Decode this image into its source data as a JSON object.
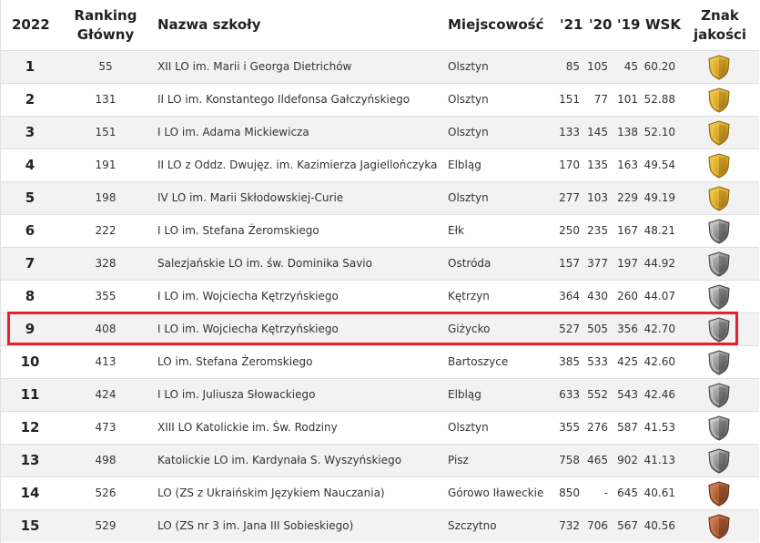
{
  "header": {
    "year": "2022",
    "ranking_line1": "Ranking",
    "ranking_line2": "Główny",
    "name": "Nazwa szkoły",
    "city": "Miejscowość",
    "y21": "'21",
    "y20": "'20",
    "y19": "'19",
    "wsk": "WSK",
    "badge_line1": "Znak",
    "badge_line2": "jakości"
  },
  "colors": {
    "highlight": "#e8202a",
    "gold": "#c9961a",
    "silver": "#7a7a7a",
    "bronze": "#9a5530"
  },
  "rows": [
    {
      "rank": "1",
      "rg": "55",
      "name": "XII LO im. Marii i Georga Dietrichów",
      "city": "Olsztyn",
      "y21": "85",
      "y20": "105",
      "y19": "45",
      "wsk": "60.20",
      "badge": "gold"
    },
    {
      "rank": "2",
      "rg": "131",
      "name": "II LO im. Konstantego Ildefonsa Gałczyńskiego",
      "city": "Olsztyn",
      "y21": "151",
      "y20": "77",
      "y19": "101",
      "wsk": "52.88",
      "badge": "gold"
    },
    {
      "rank": "3",
      "rg": "151",
      "name": "I LO im. Adama Mickiewicza",
      "city": "Olsztyn",
      "y21": "133",
      "y20": "145",
      "y19": "138",
      "wsk": "52.10",
      "badge": "gold"
    },
    {
      "rank": "4",
      "rg": "191",
      "name": "II LO z Oddz. Dwujęz. im. Kazimierza Jagiellończyka",
      "city": "Elbląg",
      "y21": "170",
      "y20": "135",
      "y19": "163",
      "wsk": "49.54",
      "badge": "gold"
    },
    {
      "rank": "5",
      "rg": "198",
      "name": "IV LO im. Marii Skłodowskiej-Curie",
      "city": "Olsztyn",
      "y21": "277",
      "y20": "103",
      "y19": "229",
      "wsk": "49.19",
      "badge": "gold"
    },
    {
      "rank": "6",
      "rg": "222",
      "name": "I LO im. Stefana Żeromskiego",
      "city": "Ełk",
      "y21": "250",
      "y20": "235",
      "y19": "167",
      "wsk": "48.21",
      "badge": "silver"
    },
    {
      "rank": "7",
      "rg": "328",
      "name": "Salezjańskie LO im. św. Dominika Savio",
      "city": "Ostróda",
      "y21": "157",
      "y20": "377",
      "y19": "197",
      "wsk": "44.92",
      "badge": "silver"
    },
    {
      "rank": "8",
      "rg": "355",
      "name": "I LO im. Wojciecha Kętrzyńskiego",
      "city": "Kętrzyn",
      "y21": "364",
      "y20": "430",
      "y19": "260",
      "wsk": "44.07",
      "badge": "silver"
    },
    {
      "rank": "9",
      "rg": "408",
      "name": "I LO im. Wojciecha Kętrzyńskiego",
      "city": "Giżycko",
      "y21": "527",
      "y20": "505",
      "y19": "356",
      "wsk": "42.70",
      "badge": "silver"
    },
    {
      "rank": "10",
      "rg": "413",
      "name": "LO im. Stefana Żeromskiego",
      "city": "Bartoszyce",
      "y21": "385",
      "y20": "533",
      "y19": "425",
      "wsk": "42.60",
      "badge": "silver"
    },
    {
      "rank": "11",
      "rg": "424",
      "name": "I LO im. Juliusza Słowackiego",
      "city": "Elbląg",
      "y21": "633",
      "y20": "552",
      "y19": "543",
      "wsk": "42.46",
      "badge": "silver"
    },
    {
      "rank": "12",
      "rg": "473",
      "name": "XIII LO Katolickie im. Św. Rodziny",
      "city": "Olsztyn",
      "y21": "355",
      "y20": "276",
      "y19": "587",
      "wsk": "41.53",
      "badge": "silver"
    },
    {
      "rank": "13",
      "rg": "498",
      "name": "Katolickie LO im. Kardynała S. Wyszyńskiego",
      "city": "Pisz",
      "y21": "758",
      "y20": "465",
      "y19": "902",
      "wsk": "41.13",
      "badge": "silver"
    },
    {
      "rank": "14",
      "rg": "526",
      "name": "LO (ZS z Ukraińskim Językiem Nauczania)",
      "city": "Górowo Iławeckie",
      "y21": "850",
      "y20": "-",
      "y19": "645",
      "wsk": "40.61",
      "badge": "bronze"
    },
    {
      "rank": "15",
      "rg": "529",
      "name": "LO (ZS nr 3 im. Jana III Sobieskiego)",
      "city": "Szczytno",
      "y21": "732",
      "y20": "706",
      "y19": "567",
      "wsk": "40.56",
      "badge": "bronze"
    }
  ]
}
